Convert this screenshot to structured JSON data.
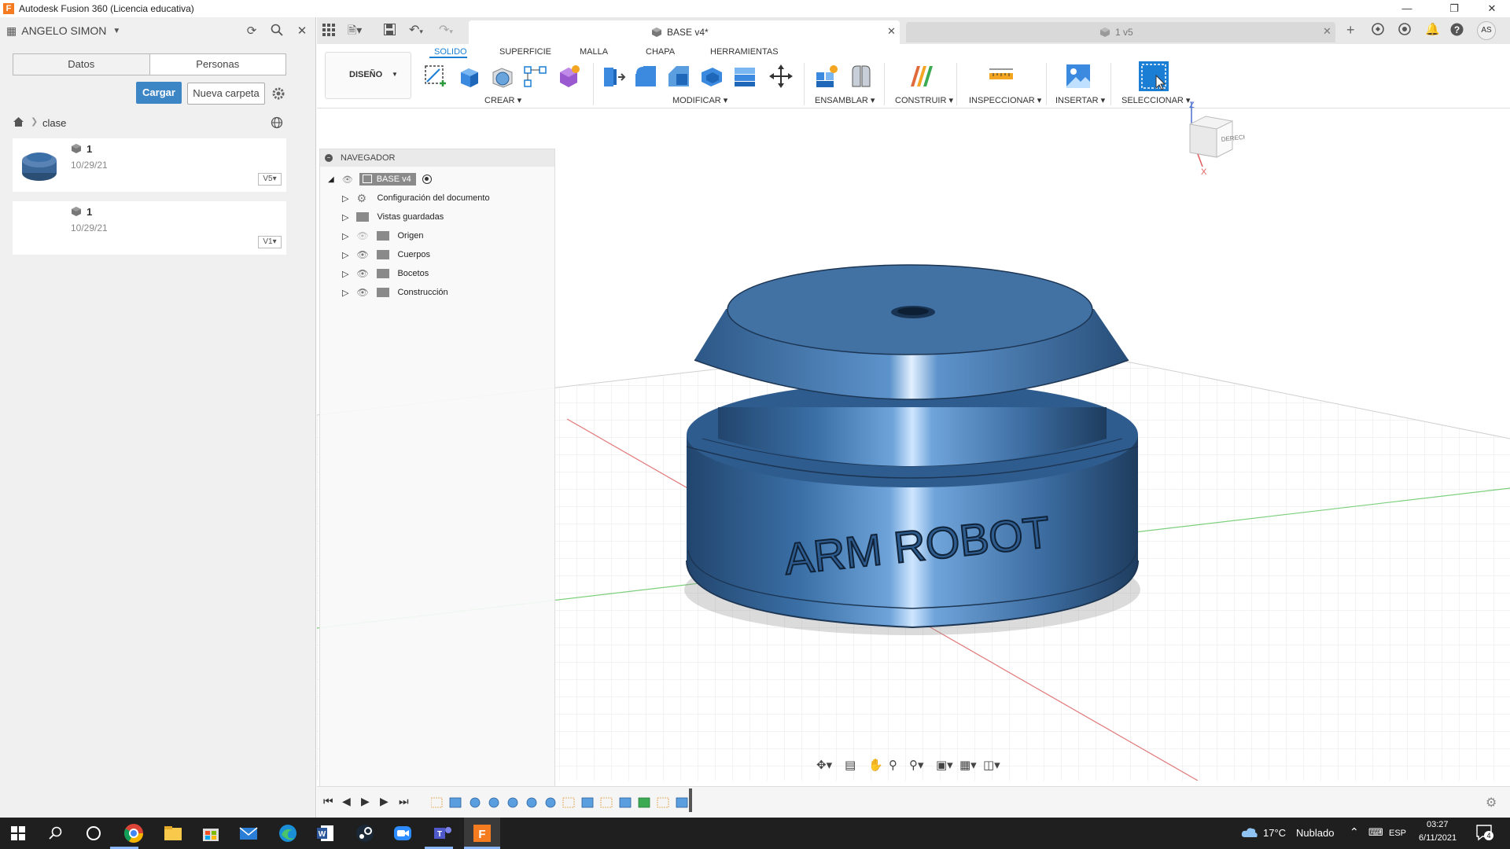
{
  "app": {
    "window_title": "Autodesk Fusion 360 (Licencia educativa)",
    "logo_letter": "F",
    "user_initials": "AS"
  },
  "data_panel": {
    "user_name": "ANGELO SIMON",
    "tabs": [
      "Datos",
      "Personas"
    ],
    "upload_label": "Cargar",
    "new_folder_label": "Nueva carpeta",
    "breadcrumb": "clase",
    "files": [
      {
        "version_count": "1",
        "date": "10/29/21",
        "badge": "V5"
      },
      {
        "version_count": "1",
        "date": "10/29/21",
        "badge": "V1"
      }
    ]
  },
  "document_tabs": [
    {
      "label": "BASE v4*",
      "active": true
    },
    {
      "label": "1 v5",
      "active": false
    }
  ],
  "ribbon": {
    "workspace": "DISEÑO",
    "tabs": [
      "SOLIDO",
      "SUPERFICIE",
      "MALLA",
      "CHAPA",
      "HERRAMIENTAS"
    ],
    "active_tab": "SOLIDO",
    "groups": [
      "CREAR",
      "MODIFICAR",
      "ENSAMBLAR",
      "CONSTRUIR",
      "INSPECCIONAR",
      "INSERTAR",
      "SELECCIONAR"
    ]
  },
  "navigator": {
    "title": "NAVEGADOR",
    "root": "BASE v4",
    "items": [
      {
        "label": "Configuración del documento",
        "icon": "gear-icon"
      },
      {
        "label": "Vistas guardadas",
        "icon": "folder-icon"
      },
      {
        "label": "Origen",
        "icon": "folder-icon"
      },
      {
        "label": "Cuerpos",
        "icon": "folder-icon"
      },
      {
        "label": "Bocetos",
        "icon": "folder-icon"
      },
      {
        "label": "Construcción",
        "icon": "folder-icon"
      }
    ]
  },
  "viewport": {
    "model_text": "ARM ROBOT",
    "viewcube_face": "DERECHA",
    "axis_z": "Z",
    "axis_x": "X"
  },
  "taskbar": {
    "temperature": "17°C",
    "weather": "Nublado",
    "language": "ESP",
    "time": "03:27",
    "date": "6/11/2021",
    "notifications": "4"
  },
  "colors": {
    "accent": "#1a7fd4",
    "primary_button": "#3d86c6",
    "model_blue": "#3b6fa8",
    "taskbar": "#1f1f1f"
  }
}
